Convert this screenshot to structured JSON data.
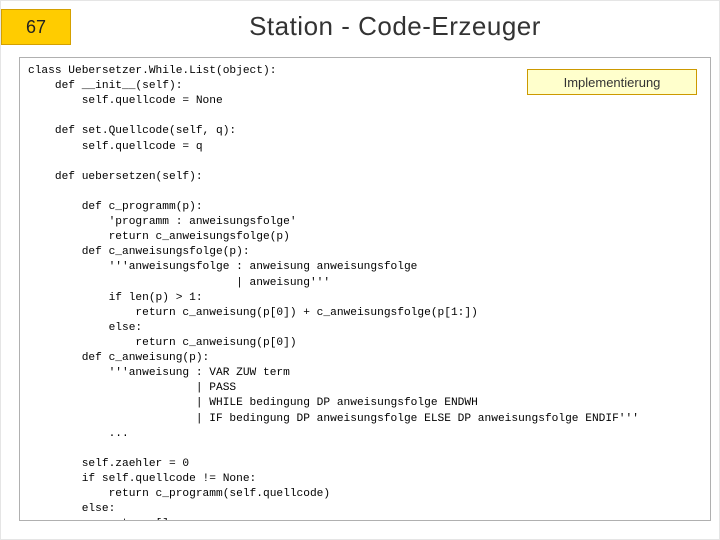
{
  "slide": {
    "number": "67",
    "title": "Station - Code-Erzeuger"
  },
  "callout": {
    "label": "Implementierung"
  },
  "code": {
    "text": "class Uebersetzer.While.List(object):\n    def __init__(self):\n        self.quellcode = None\n\n    def set.Quellcode(self, q):\n        self.quellcode = q\n\n    def uebersetzen(self):\n\n        def c_programm(p):\n            'programm : anweisungsfolge'\n            return c_anweisungsfolge(p)\n        def c_anweisungsfolge(p):\n            '''anweisungsfolge : anweisung anweisungsfolge\n                               | anweisung'''\n            if len(p) > 1:\n                return c_anweisung(p[0]) + c_anweisungsfolge(p[1:])\n            else:\n                return c_anweisung(p[0])\n        def c_anweisung(p):\n            '''anweisung : VAR ZUW term\n                         | PASS\n                         | WHILE bedingung DP anweisungsfolge ENDWH\n                         | IF bedingung DP anweisungsfolge ELSE DP anweisungsfolge ENDIF'''\n            ...\n\n        self.zaehler = 0\n        if self.quellcode != None:\n            return c_programm(self.quellcode)\n        else:\n            return []"
  }
}
